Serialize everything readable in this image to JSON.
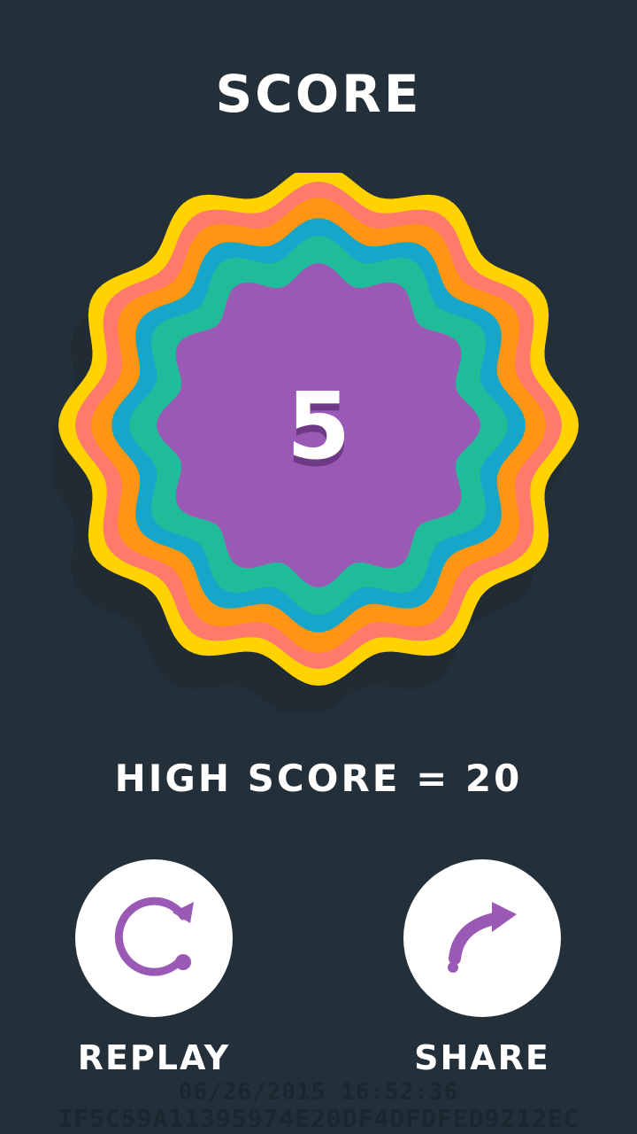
{
  "title": "SCORE",
  "score": "5",
  "high_score_text": "HIGH SCORE = 20",
  "buttons": {
    "replay": {
      "label": "REPLAY",
      "icon": "replay-icon"
    },
    "share": {
      "label": "SHARE",
      "icon": "share-icon"
    }
  },
  "watermark": {
    "timestamp": "06/26/2015 16:52:36",
    "id": "IF5C59A11395974E20DF4DFDFED9212EC"
  },
  "colors": {
    "background": "#243039",
    "rings": [
      "#FFD302",
      "#FF7A6B",
      "#FF9512",
      "#16A6C9",
      "#20BC9A",
      "#9B59B6"
    ],
    "accent": "#9B59B6"
  }
}
